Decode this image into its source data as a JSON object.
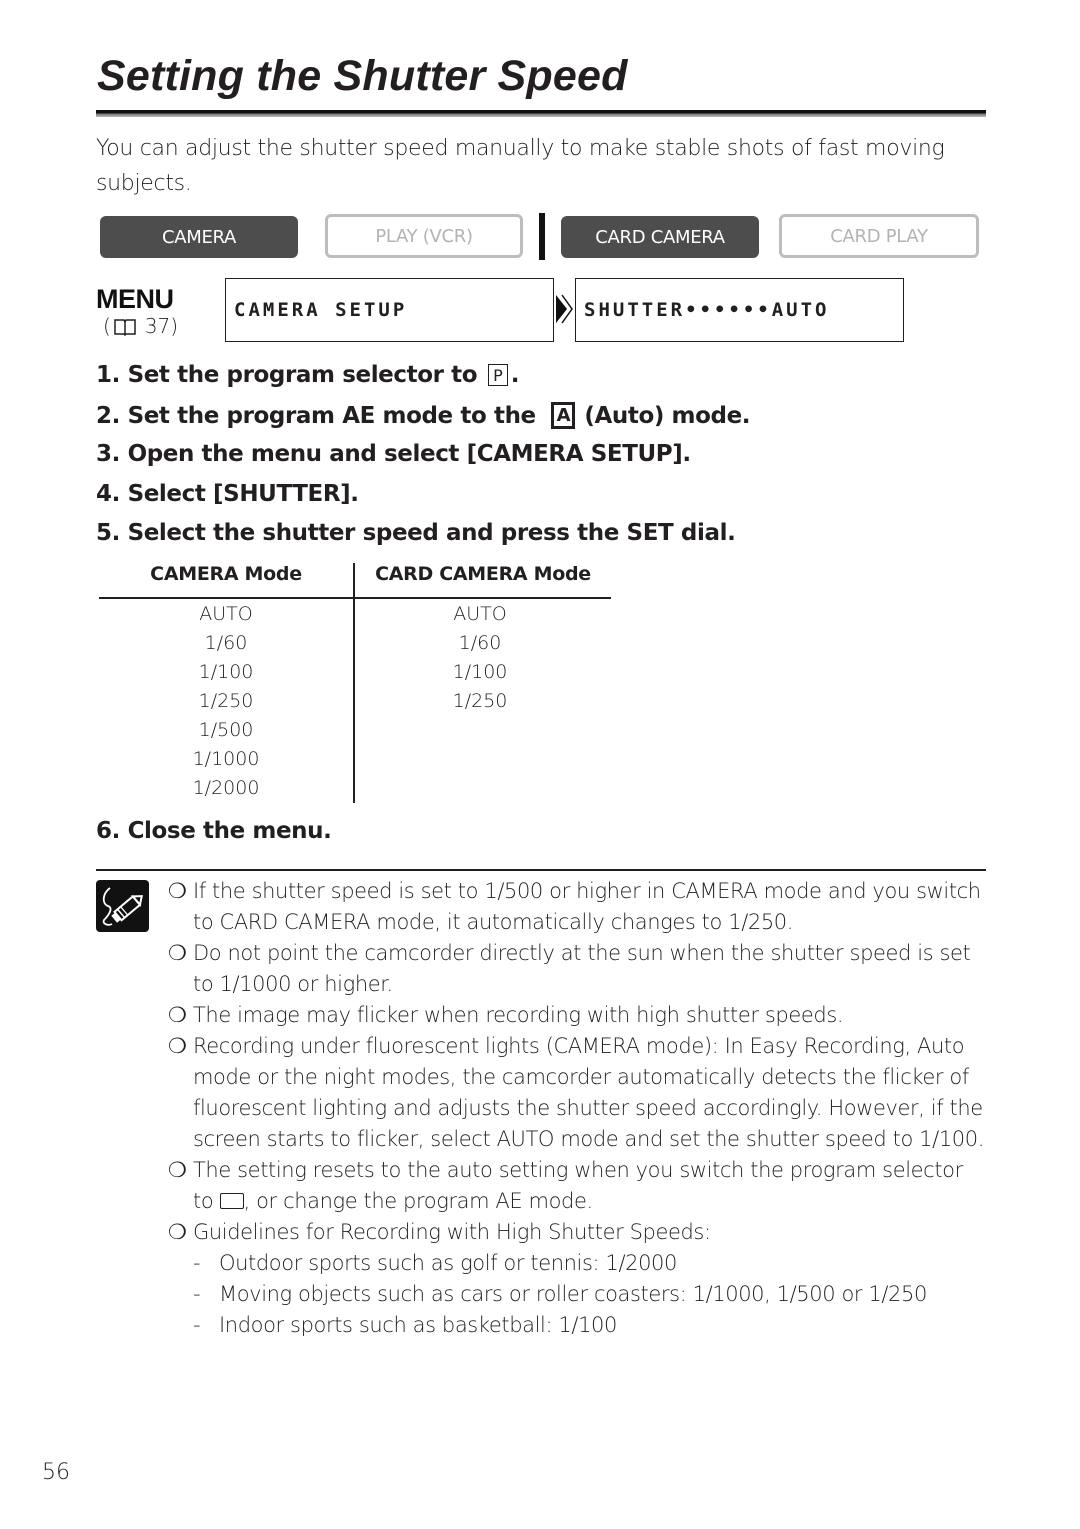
{
  "title": "Setting the Shutter Speed",
  "intro": "You can adjust the shutter speed manually to make stable shots of fast moving subjects.",
  "modes": [
    {
      "label": "CAMERA",
      "state": "active"
    },
    {
      "label": "PLAY (VCR)",
      "state": "inactive"
    },
    {
      "label": "CARD CAMERA",
      "state": "active"
    },
    {
      "label": "CARD PLAY",
      "state": "inactive"
    }
  ],
  "menu": {
    "logo": "MENU",
    "ref_open": "(",
    "ref_icon": "book-icon",
    "ref_page": "37)",
    "path": [
      "CAMERA SETUP",
      "SHUTTER••••••AUTO"
    ],
    "arrow_icon": "double-chevron-right-icon"
  },
  "steps": [
    {
      "num": "1.",
      "pre": "Set the program selector to ",
      "glyph": "P",
      "post": "."
    },
    {
      "num": "2.",
      "pre": "Set the program AE mode to the ",
      "glyph": "A",
      "post": "(Auto) mode."
    },
    {
      "num": "3.",
      "text": "Open the menu and select [CAMERA SETUP]."
    },
    {
      "num": "4.",
      "text": "Select [SHUTTER]."
    },
    {
      "num": "5.",
      "text": "Select the shutter speed and press the SET dial."
    },
    {
      "num": "6.",
      "text": "Close the menu."
    }
  ],
  "shutter_table": {
    "headers": [
      "CAMERA Mode",
      "CARD CAMERA Mode"
    ],
    "camera_mode": [
      "AUTO",
      "1/60",
      "1/100",
      "1/250",
      "1/500",
      "1/1000",
      "1/2000"
    ],
    "card_camera_mode": [
      "AUTO",
      "1/60",
      "1/100",
      "1/250"
    ]
  },
  "notes": {
    "icon": "note-pencil-icon",
    "bullet": "❍",
    "items": [
      "If the shutter speed is set to 1/500 or higher in CAMERA mode and you switch to CARD CAMERA mode, it automatically changes to 1/250.",
      "Do not point the camcorder directly at the sun when the shutter speed is set to 1/1000 or higher.",
      "The image may flicker when recording with high shutter speeds.",
      "Recording under fluorescent lights (CAMERA mode): In Easy Recording, Auto mode or the night modes, the camcorder automatically detects the flicker of fluorescent lighting and adjusts the shutter speed accordingly. However, if the screen starts to flicker, select AUTO mode and set the shutter speed to 1/100."
    ],
    "reset_note": {
      "pre": "The setting resets to the auto setting when you switch the program selector to ",
      "icon": "easy-recording-icon",
      "post": ", or change the program AE mode."
    },
    "guidelines": {
      "heading": "Guidelines for Recording with High Shutter Speeds:",
      "items": [
        "Outdoor sports such as golf or tennis: 1/2000",
        "Moving objects such as cars or roller coasters: 1/1000, 1/500 or 1/250",
        "Indoor sports such as basketball: 1/100"
      ]
    }
  },
  "page_number": "56"
}
